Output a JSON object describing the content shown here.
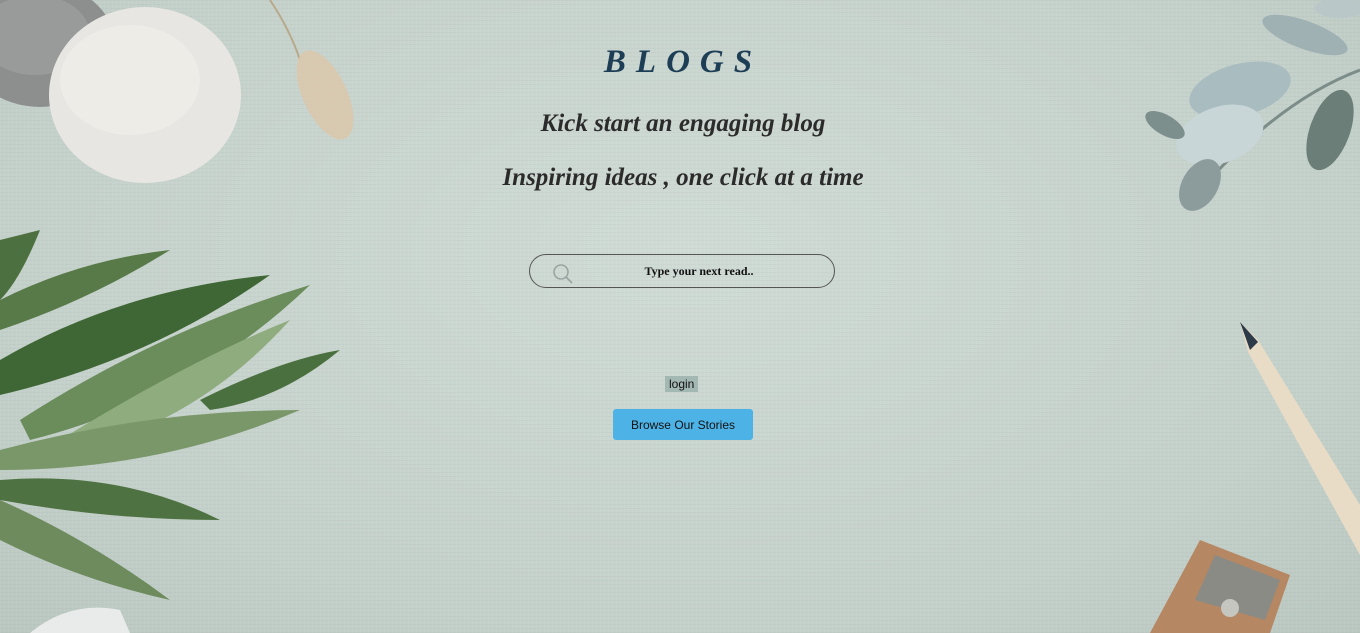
{
  "hero": {
    "title": "BLOGS",
    "subtitle_1": "Kick start an engaging blog",
    "subtitle_2": "Inspiring ideas , one click at a time"
  },
  "search": {
    "placeholder": "Type your next read..",
    "value": "",
    "icon": "search-icon"
  },
  "actions": {
    "login_label": "login",
    "browse_label": "Browse Our Stories"
  },
  "colors": {
    "background": "#c9d5cf",
    "title": "#1d3e55",
    "text": "#2b2b2b",
    "login_bg": "#a3b7b3",
    "browse_bg": "#4db3e6"
  }
}
